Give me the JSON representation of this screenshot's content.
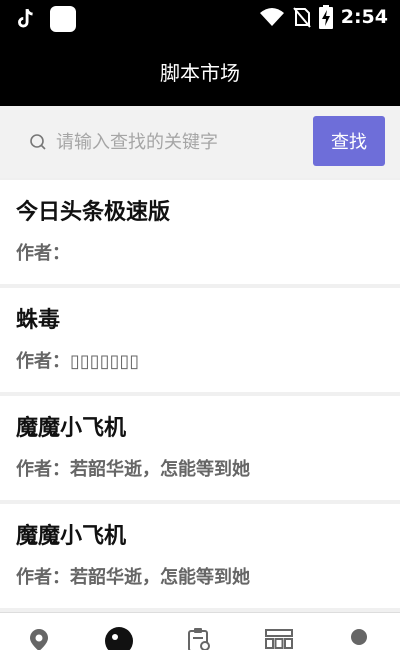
{
  "status_bar": {
    "time": "2:54",
    "icons": [
      "tiktok-icon",
      "app-square-icon",
      "wifi-icon",
      "no-sim-icon",
      "battery-charging-icon"
    ]
  },
  "header": {
    "title": "脚本市场"
  },
  "search": {
    "placeholder": "请输入查找的关键字",
    "button_label": "查找"
  },
  "items": [
    {
      "title": "今日头条极速版",
      "author_label": "作者：",
      "author": ""
    },
    {
      "title": "蛛毒",
      "author_label": "作者：",
      "author": "▯▯▯▯▯▯▯"
    },
    {
      "title": "魔魔小飞机",
      "author_label": "作者：",
      "author": "若韶华逝，怎能等到她"
    },
    {
      "title": "魔魔小飞机",
      "author_label": "作者：",
      "author": "若韶华逝，怎能等到她"
    }
  ],
  "bottom_nav": {
    "items": [
      "location-icon",
      "market-icon",
      "clipboard-icon",
      "grid-icon",
      "profile-icon"
    ],
    "active_index": 1
  },
  "colors": {
    "accent": "#6e6ed9",
    "header_bg": "#000000"
  }
}
